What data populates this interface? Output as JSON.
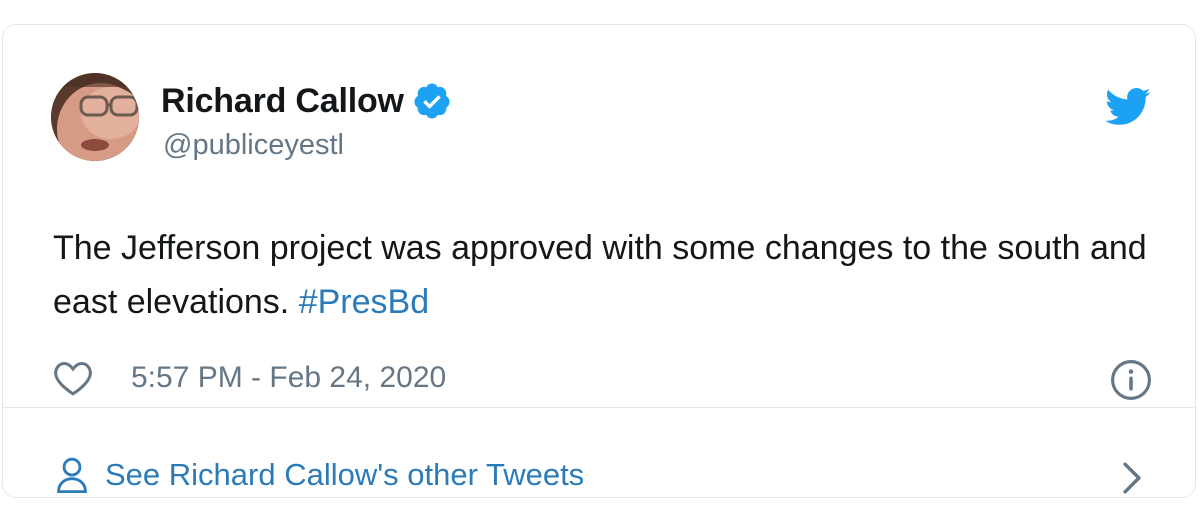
{
  "author": {
    "name": "Richard Callow",
    "handle": "@publiceyestl",
    "verified": true
  },
  "tweet": {
    "text": "The Jefferson project was approved with some changes to the south and east elevations. ",
    "hashtag": "#PresBd",
    "timestamp": "5:57 PM - Feb 24, 2020"
  },
  "footer": {
    "link_label": "See Richard Callow's other Tweets"
  },
  "icons": {
    "brand": "twitter-bird-icon",
    "like": "heart-icon",
    "info": "info-icon",
    "profile": "person-icon",
    "chevron": "chevron-right-icon"
  },
  "colors": {
    "brand_blue": "#1da1f2",
    "link_blue": "#2b7bb9",
    "text": "#14171a",
    "muted": "#657786",
    "border": "#e1e8ed"
  }
}
